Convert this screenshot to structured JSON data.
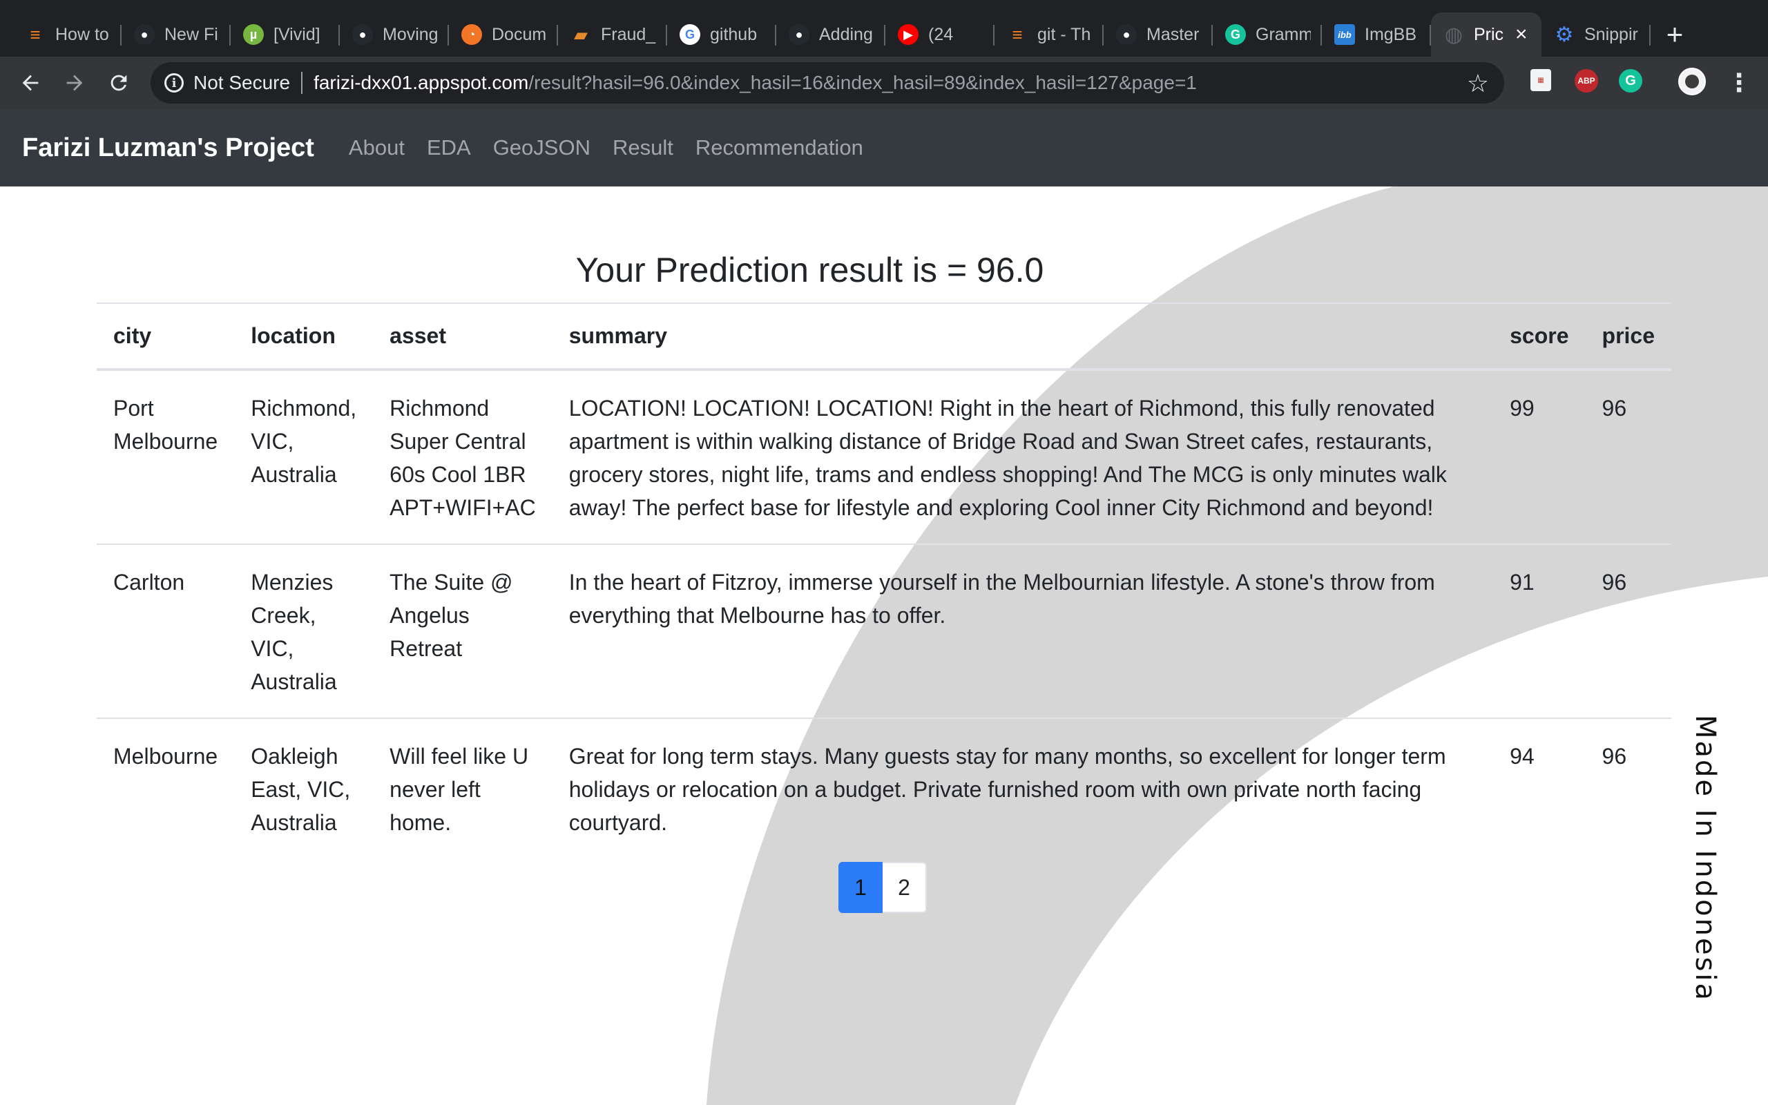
{
  "browser": {
    "tabs": [
      {
        "title": "How to",
        "icon": "stackoverflow-icon",
        "color": "#f48024"
      },
      {
        "title": "New Fi",
        "icon": "github-icon",
        "color": "#24292e"
      },
      {
        "title": "[Vivid]",
        "icon": "utorrent-icon",
        "color": "#76b83f"
      },
      {
        "title": "Moving",
        "icon": "github-icon",
        "color": "#24292e"
      },
      {
        "title": "Docum",
        "icon": "jupyter-icon",
        "color": "#f37626"
      },
      {
        "title": "Fraud_",
        "icon": "book-icon",
        "color": "#e88a2b"
      },
      {
        "title": "github",
        "icon": "google-icon",
        "color": "#ffffff"
      },
      {
        "title": "Adding",
        "icon": "github-icon",
        "color": "#24292e"
      },
      {
        "title": "(24",
        "icon": "youtube-icon",
        "color": "#ff0000"
      },
      {
        "title": "git - Th",
        "icon": "stackoverflow-icon",
        "color": "#f48024"
      },
      {
        "title": "Master",
        "icon": "github-icon",
        "color": "#24292e"
      },
      {
        "title": "Gramm",
        "icon": "grammarly-icon",
        "color": "#15c39a"
      },
      {
        "title": "ImgBB",
        "icon": "imgbb-icon",
        "color": "#2a7fd4"
      },
      {
        "title": "Pric",
        "icon": "globe-icon",
        "color": "#5f6368",
        "active": true
      },
      {
        "title": "Snippir",
        "icon": "gear-icon",
        "color": "#4a8af4"
      }
    ],
    "omnibox": {
      "security_label": "Not Secure",
      "host": "farizi-dxx01.appspot.com",
      "path": "/result?hasil=96.0&index_hasil=16&index_hasil=89&index_hasil=127&page=1"
    },
    "extensions": {
      "abp": "ABP",
      "grammarly": "G"
    }
  },
  "site": {
    "brand": "Farizi Luzman's Project",
    "nav": [
      "About",
      "EDA",
      "GeoJSON",
      "Result",
      "Recommendation"
    ]
  },
  "main": {
    "headline": "Your Prediction result is = 96.0",
    "table": {
      "headers": [
        "city",
        "location",
        "asset",
        "summary",
        "score",
        "price"
      ],
      "rows": [
        {
          "city": "Port Melbourne",
          "location": "Richmond, VIC, Australia",
          "asset": "Richmond Super Central 60s Cool 1BR APT+WIFI+AC",
          "summary": "LOCATION! LOCATION! LOCATION! Right in the heart of Richmond, this fully renovated apartment is within walking distance of Bridge Road and Swan Street cafes, restaurants, grocery stores, night life, trams and endless shopping! And The MCG is only minutes walk away! The perfect base for lifestyle and exploring Cool inner City Richmond and beyond!",
          "score": "99",
          "price": "96"
        },
        {
          "city": "Carlton",
          "location": "Menzies Creek, VIC, Australia",
          "asset": "The Suite @ Angelus Retreat",
          "summary": "In the heart of Fitzroy, immerse yourself in the Melbournian lifestyle. A stone's throw from everything that Melbourne has to offer.",
          "score": "91",
          "price": "96"
        },
        {
          "city": "Melbourne",
          "location": "Oakleigh East, VIC, Australia",
          "asset": "Will feel like U never left home.",
          "summary": "Great for long term stays. Many guests stay for many months, so excellent for longer term holidays or relocation on a budget. Private furnished room with own private north facing courtyard.",
          "score": "94",
          "price": "96"
        }
      ]
    },
    "pagination": {
      "pages": [
        "1",
        "2"
      ],
      "current": "1"
    },
    "side_text": "Made In Indonesia"
  },
  "colors": {
    "navbar_bg": "#343a40",
    "accent": "#2b7cf6",
    "deco_arc": "#d6d6d6"
  }
}
